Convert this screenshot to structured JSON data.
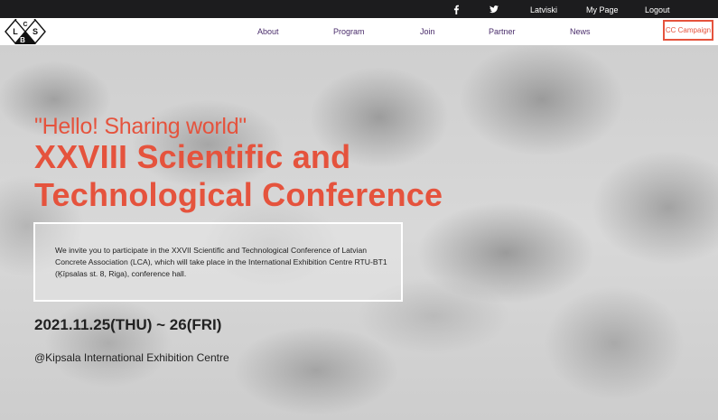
{
  "topbar": {
    "facebook_icon": "facebook-icon",
    "twitter_icon": "twitter-icon",
    "language": "Latviski",
    "my_page": "My Page",
    "logout": "Logout"
  },
  "logo": {
    "letters": [
      "L",
      "B",
      "S",
      "C"
    ]
  },
  "nav": {
    "items": [
      {
        "label": "About"
      },
      {
        "label": "Program"
      },
      {
        "label": "Join"
      },
      {
        "label": "Partner"
      },
      {
        "label": "News"
      }
    ],
    "cc_campaign": "CC Campaign"
  },
  "hero": {
    "greeting": "\"Hello! Sharing world\"",
    "title_line1": "XXVIII Scientific and",
    "title_line2": "Technological Conference",
    "invitation": "We invite you to participate in the XXVII Scientific and Technological Conference of Latvian Concrete Association (LCA), which will take place in the International Exhibition Centre RTU-BT1 (Ķīpsalas st. 8, Riga), conference hall.",
    "dates": "2021.11.25(THU) ~ 26(FRI)",
    "venue": "@Kipsala International Exhibition Centre"
  },
  "colors": {
    "accent": "#e5533d",
    "nav_text": "#4a2d6b",
    "topbar_bg": "#1c1c1e"
  }
}
